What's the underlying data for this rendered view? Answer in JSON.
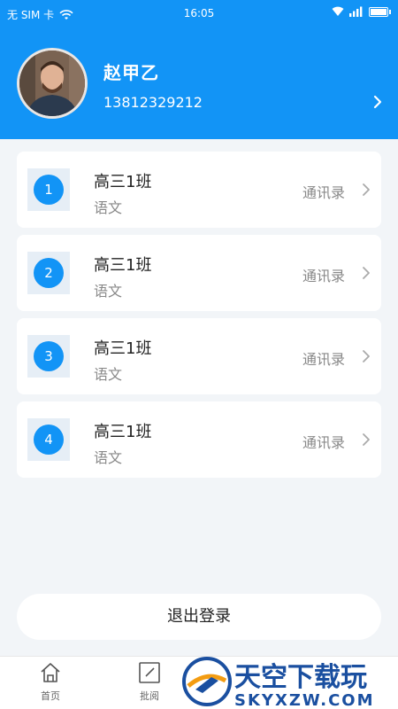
{
  "status_bar": {
    "carrier": "无 SIM 卡",
    "time": "16:05"
  },
  "profile": {
    "name": "赵甲乙",
    "phone": "13812329212"
  },
  "classes": [
    {
      "index": "1",
      "name": "高三1班",
      "subject": "语文",
      "link_label": "通讯录"
    },
    {
      "index": "2",
      "name": "高三1班",
      "subject": "语文",
      "link_label": "通讯录"
    },
    {
      "index": "3",
      "name": "高三1班",
      "subject": "语文",
      "link_label": "通讯录"
    },
    {
      "index": "4",
      "name": "高三1班",
      "subject": "语文",
      "link_label": "通讯录"
    }
  ],
  "logout_label": "退出登录",
  "tabs": [
    {
      "label": "首页",
      "icon": "home-icon"
    },
    {
      "label": "批阅",
      "icon": "edit-icon"
    }
  ],
  "watermark": {
    "title": "天空下载玩",
    "url": "SKYXZW.COM"
  },
  "colors": {
    "primary": "#1294f6",
    "background": "#f2f5f8",
    "watermark_orange": "#f39c12"
  }
}
